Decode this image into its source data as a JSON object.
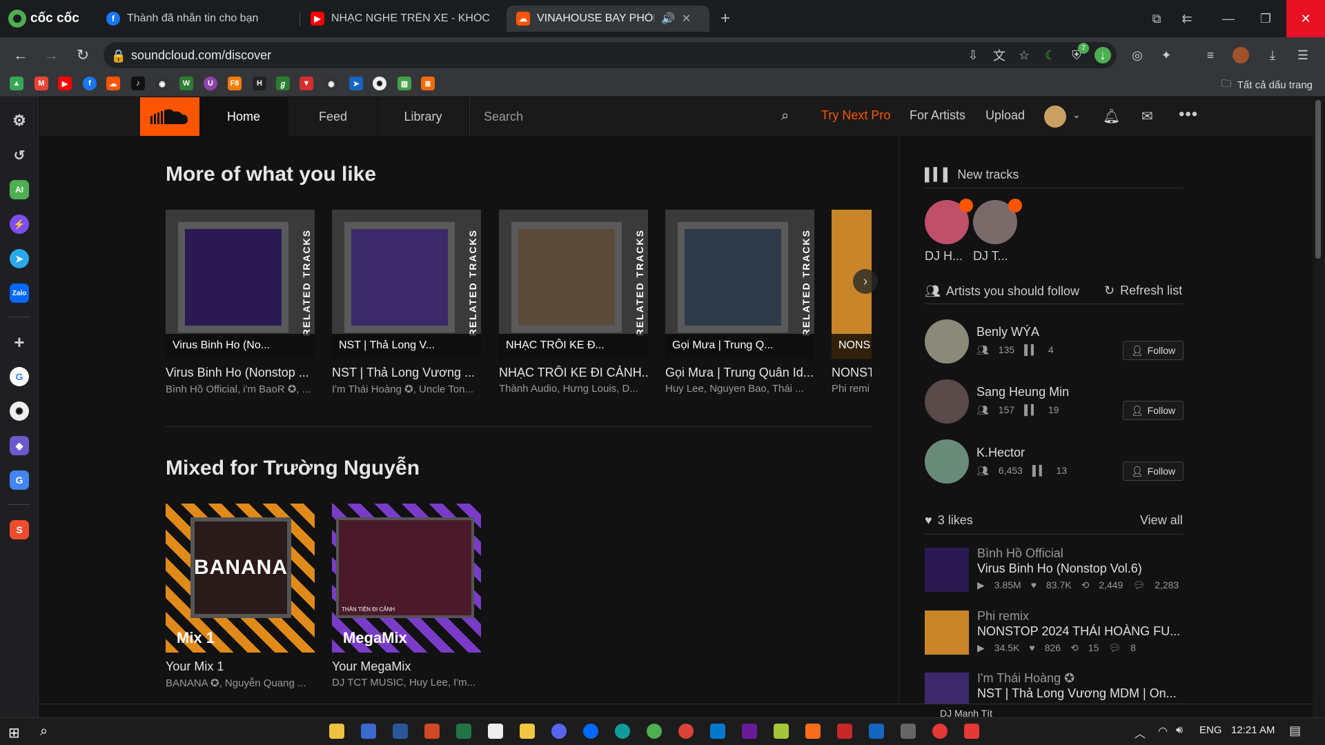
{
  "browser": {
    "brand": "cốc cốc",
    "tabs": [
      {
        "label": "Thành đã nhắn tin cho bạn",
        "fav_color": "#1877f2",
        "fav": "f"
      },
      {
        "label": "NHẠC NGHE TRÊN XE - KHÓC CỦ",
        "fav_color": "#ff0000",
        "fav": "▶"
      },
      {
        "label": "VINAHOUSE BAY PHÒNG",
        "fav_color": "#ff5500",
        "fav": "☁"
      }
    ],
    "url": "soundcloud.com/discover",
    "shield_badge": "7",
    "all_bookmarks": "Tất cả dấu trang"
  },
  "sc_header": {
    "home": "Home",
    "feed": "Feed",
    "library": "Library",
    "search_placeholder": "Search",
    "try_next_pro": "Try Next Pro",
    "for_artists": "For Artists",
    "upload": "Upload",
    "accent": "#ff5500"
  },
  "section1": {
    "title": "More of what you like",
    "cards": [
      {
        "caption": "Virus Binh Ho (No...",
        "title": "Virus Binh Ho (Nonstop ...",
        "sub": "Bình Hồ Official, i'm BaoR ✪, ...",
        "side": "RELATED TRACKS",
        "color": "#2b1a52"
      },
      {
        "caption": "NST | Thả Long V...",
        "title": "NST | Thả Long Vương ...",
        "sub": "I'm Thái Hoàng ✪, Uncle Ton...",
        "side": "RELATED TRACKS",
        "color": "#3a2a6a"
      },
      {
        "caption": "NHẠC TRÔI KE Đ...",
        "title": "NHẠC TRÔI KE ĐI CẢNH...",
        "sub": "Thành Audio, Hưng Louis, D...",
        "side": "RELATED TRACKS",
        "color": "#5a4a3a"
      },
      {
        "caption": "Gọi Mưa | Trung Q...",
        "title": "Gọi Mưa | Trung Quân Id...",
        "sub": "Huy Lee, Nguyen Bao, Thái ...",
        "side": "RELATED TRACKS",
        "color": "#2f3a4a"
      },
      {
        "caption": "NONS",
        "title": "NONST",
        "sub": "Phi remi",
        "side": "",
        "color": "#c8852a"
      }
    ]
  },
  "section2": {
    "title": "Mixed for Trường Nguyễn",
    "mixes": [
      {
        "label": "Mix 1",
        "art_text": "BANANA",
        "title": "Your Mix 1",
        "sub": "BANANA ✪, Nguyễn Quang ..."
      },
      {
        "label": "MegaMix",
        "art_text": "THÂN TIÊN ĐI CẢNH",
        "title": "Your MegaMix",
        "sub": "DJ TCT MUSIC, Huy Lee, I'm..."
      }
    ]
  },
  "sidebar": {
    "new_tracks": "New tracks",
    "new_tracks_users": [
      "DJ H...",
      "DJ T..."
    ],
    "artists_title": "Artists you should follow",
    "refresh": "Refresh list",
    "follow_label": "Follow",
    "artists": [
      {
        "name": "Benly WÝA",
        "followers": "135",
        "tracks": "4"
      },
      {
        "name": "Sang Heung Min",
        "followers": "157",
        "tracks": "19"
      },
      {
        "name": "K.Hector",
        "followers": "6,453",
        "tracks": "13"
      }
    ],
    "likes_title": "3 likes",
    "view_all": "View all",
    "likes": [
      {
        "user": "Bình Hồ Official",
        "title": "Virus Binh Ho (Nonstop Vol.6)",
        "plays": "3.85M",
        "likes": "83.7K",
        "reposts": "2,449",
        "comments": "2,283"
      },
      {
        "user": "Phi remix",
        "title": "NONSTOP 2024 THÁI HOÀNG FU...",
        "plays": "34.5K",
        "likes": "826",
        "reposts": "15",
        "comments": "8"
      },
      {
        "user": "I'm Thái Hoàng ✪",
        "title": "NST | Thả Long Vương MDM | On..."
      }
    ],
    "player_peek": "DJ Mạnh Tít"
  },
  "taskbar": {
    "lang": "ENG",
    "time": "12:21 AM"
  }
}
